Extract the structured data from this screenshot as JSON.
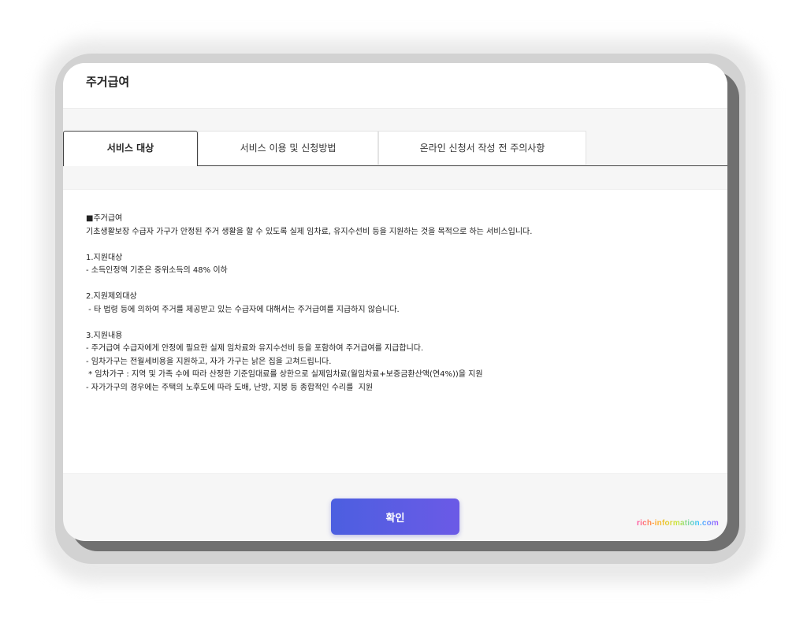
{
  "dialog": {
    "title": "주거급여"
  },
  "tabs": [
    {
      "label": "서비스 대상",
      "active": true
    },
    {
      "label": "서비스 이용 및 신청방법",
      "active": false
    },
    {
      "label": "온라인 신청서 작성 전 주의사항",
      "active": false
    }
  ],
  "content": {
    "heading": "■주거급여",
    "intro": "기초생활보장 수급자 가구가 안정된 주거 생활을 할 수 있도록 실제 임차료, 유지수선비 등을 지원하는 것을 목적으로 하는 서비스입니다.",
    "section1": {
      "title": "1.지원대상",
      "lines": [
        "- 소득인정액 기준은 중위소득의 48% 이하"
      ]
    },
    "section2": {
      "title": "2.지원제외대상",
      "lines": [
        " - 타 법령 등에 의하여 주거를 제공받고 있는 수급자에 대해서는 주거급여를 지급하지 않습니다."
      ]
    },
    "section3": {
      "title": "3.지원내용",
      "lines": [
        "- 주거급여 수급자에게 안정에 필요한 실제 임차료와 유지수선비 등을 포함하여 주거급여를 지급합니다.",
        "- 임차가구는 전월세비용을 지원하고, 자가 가구는 낡은 집을 고쳐드립니다.",
        " * 임차가구 : 지역 및 가족 수에 따라 산정한 기준임대료를 상한으로 실제임차료(월임차료+보증금환산액(연4%))을 지원",
        "- 자가가구의 경우에는 주택의 노후도에 따라 도배, 난방, 지붕 등 종합적인 수리를  지원"
      ]
    }
  },
  "footer": {
    "confirm_label": "확인",
    "watermark": "rich-information.com"
  },
  "colors": {
    "accent_start": "#4c5fe0",
    "accent_end": "#6b5ae6",
    "tab_border": "#444444"
  }
}
